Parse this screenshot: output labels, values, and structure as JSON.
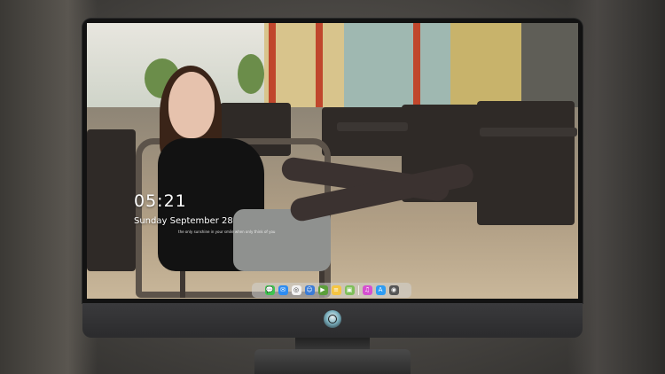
{
  "lockscreen": {
    "time": "05:21",
    "date": "Sunday  September  28",
    "subtitle": "the only sunshine in your smile when only think of you"
  },
  "dock": {
    "apps": [
      {
        "name": "messages-icon",
        "glyph": "💬",
        "color": "#3fc44f"
      },
      {
        "name": "mail-icon",
        "glyph": "✉",
        "color": "#2d8cf0"
      },
      {
        "name": "browser-icon",
        "glyph": "◎",
        "color": "#f2f2f2"
      },
      {
        "name": "finder-icon",
        "glyph": "☺",
        "color": "#3a7bd5"
      },
      {
        "name": "video-icon",
        "glyph": "▶",
        "color": "#5b9f3a"
      },
      {
        "name": "notes-icon",
        "glyph": "≡",
        "color": "#f5c542"
      },
      {
        "name": "photos-icon",
        "glyph": "▣",
        "color": "#7fbf5a"
      },
      {
        "name": "music-icon",
        "glyph": "♫",
        "color": "#d64fd0"
      },
      {
        "name": "appstore-icon",
        "glyph": "A",
        "color": "#2e9cf2"
      },
      {
        "name": "camera-icon",
        "glyph": "◉",
        "color": "#555555"
      }
    ]
  }
}
